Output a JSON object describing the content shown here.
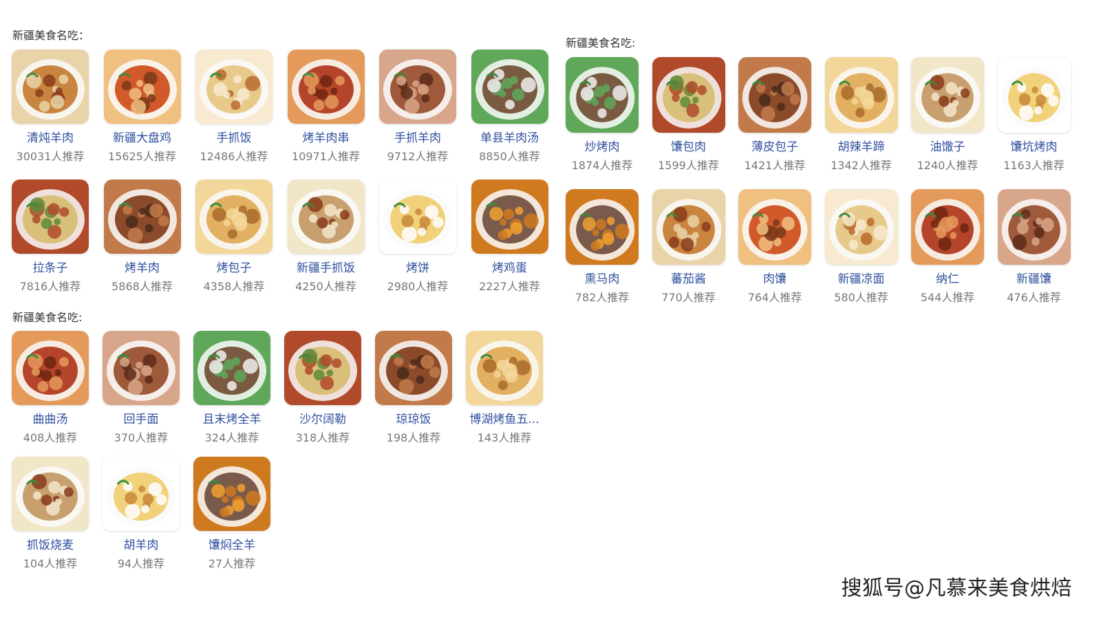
{
  "panels": {
    "top_left": {
      "title": "新疆美食名吃：",
      "items": [
        {
          "name": "清炖羊肉",
          "count": "30031人推荐",
          "icon": "stewed-mutton-photo"
        },
        {
          "name": "新疆大盘鸡",
          "count": "15625人推荐",
          "icon": "big-plate-chicken-photo"
        },
        {
          "name": "手抓饭",
          "count": "12486人推荐",
          "icon": "pilaf-photo"
        },
        {
          "name": "烤羊肉串",
          "count": "10971人推荐",
          "icon": "lamb-skewers-photo"
        },
        {
          "name": "手抓羊肉",
          "count": "9712人推荐",
          "icon": "hand-grabbed-mutton-photo"
        },
        {
          "name": "单县羊肉汤",
          "count": "8850人推荐",
          "icon": "mutton-soup-photo"
        },
        {
          "name": "拉条子",
          "count": "7816人推荐",
          "icon": "pulled-noodles-photo"
        },
        {
          "name": "烤羊肉",
          "count": "5868人推荐",
          "icon": "roast-lamb-photo"
        },
        {
          "name": "烤包子",
          "count": "4358人推荐",
          "icon": "baked-buns-photo"
        },
        {
          "name": "新疆手抓饭",
          "count": "4250人推荐",
          "icon": "xinjiang-pilaf-photo"
        },
        {
          "name": "烤饼",
          "count": "2980人推荐",
          "icon": "baked-cake-photo"
        },
        {
          "name": "烤鸡蛋",
          "count": "2227人推荐",
          "icon": "roast-eggs-photo"
        }
      ]
    },
    "bottom_left": {
      "title": "新疆美食名吃:",
      "items": [
        {
          "name": "曲曲汤",
          "count": "408人推荐",
          "icon": "ququ-soup-photo"
        },
        {
          "name": "回手面",
          "count": "370人推荐",
          "icon": "huishou-noodles-photo"
        },
        {
          "name": "且末烤全羊",
          "count": "324人推荐",
          "icon": "whole-roast-lamb-photo"
        },
        {
          "name": "沙尔阔勒",
          "count": "318人推荐",
          "icon": "shaerkuole-photo"
        },
        {
          "name": "琼琼饭",
          "count": "198人推荐",
          "icon": "qiongqiong-rice-photo"
        },
        {
          "name": "博湖烤鱼五...",
          "count": "143人推荐",
          "icon": "bohu-grilled-fish-photo"
        },
        {
          "name": "抓饭烧麦",
          "count": "104人推荐",
          "icon": "pilaf-shaomai-photo"
        },
        {
          "name": "胡羊肉",
          "count": "94人推荐",
          "icon": "hu-mutton-photo"
        },
        {
          "name": "馕焖全羊",
          "count": "27人推荐",
          "icon": "naan-braised-lamb-photo"
        }
      ]
    },
    "right": {
      "title": "新疆美食名吃:",
      "items": [
        {
          "name": "炒烤肉",
          "count": "1874人推荐",
          "icon": "stir-fried-meat-photo"
        },
        {
          "name": "馕包肉",
          "count": "1599人推荐",
          "icon": "naan-meat-photo"
        },
        {
          "name": "薄皮包子",
          "count": "1421人推荐",
          "icon": "thin-skin-buns-photo"
        },
        {
          "name": "胡辣羊蹄",
          "count": "1342人推荐",
          "icon": "spicy-trotters-photo"
        },
        {
          "name": "油馓子",
          "count": "1240人推荐",
          "icon": "fried-sanzi-photo"
        },
        {
          "name": "馕坑烤肉",
          "count": "1163人推荐",
          "icon": "tandoor-meat-photo"
        },
        {
          "name": "熏马肉",
          "count": "782人推荐",
          "icon": "smoked-horse-meat-photo"
        },
        {
          "name": "蕃茄酱",
          "count": "770人推荐",
          "icon": "tomato-sauce-photo"
        },
        {
          "name": "肉馕",
          "count": "764人推荐",
          "icon": "meat-naan-photo"
        },
        {
          "name": "新疆凉面",
          "count": "580人推荐",
          "icon": "cold-noodles-photo"
        },
        {
          "name": "纳仁",
          "count": "544人推荐",
          "icon": "naren-photo"
        },
        {
          "name": "新疆馕",
          "count": "476人推荐",
          "icon": "xinjiang-naan-photo"
        }
      ]
    }
  },
  "watermark": "搜狐号@凡慕来美食烘焙",
  "colors": {
    "item_name": "#2f4f9e",
    "item_count": "#777777",
    "title": "#333333"
  }
}
